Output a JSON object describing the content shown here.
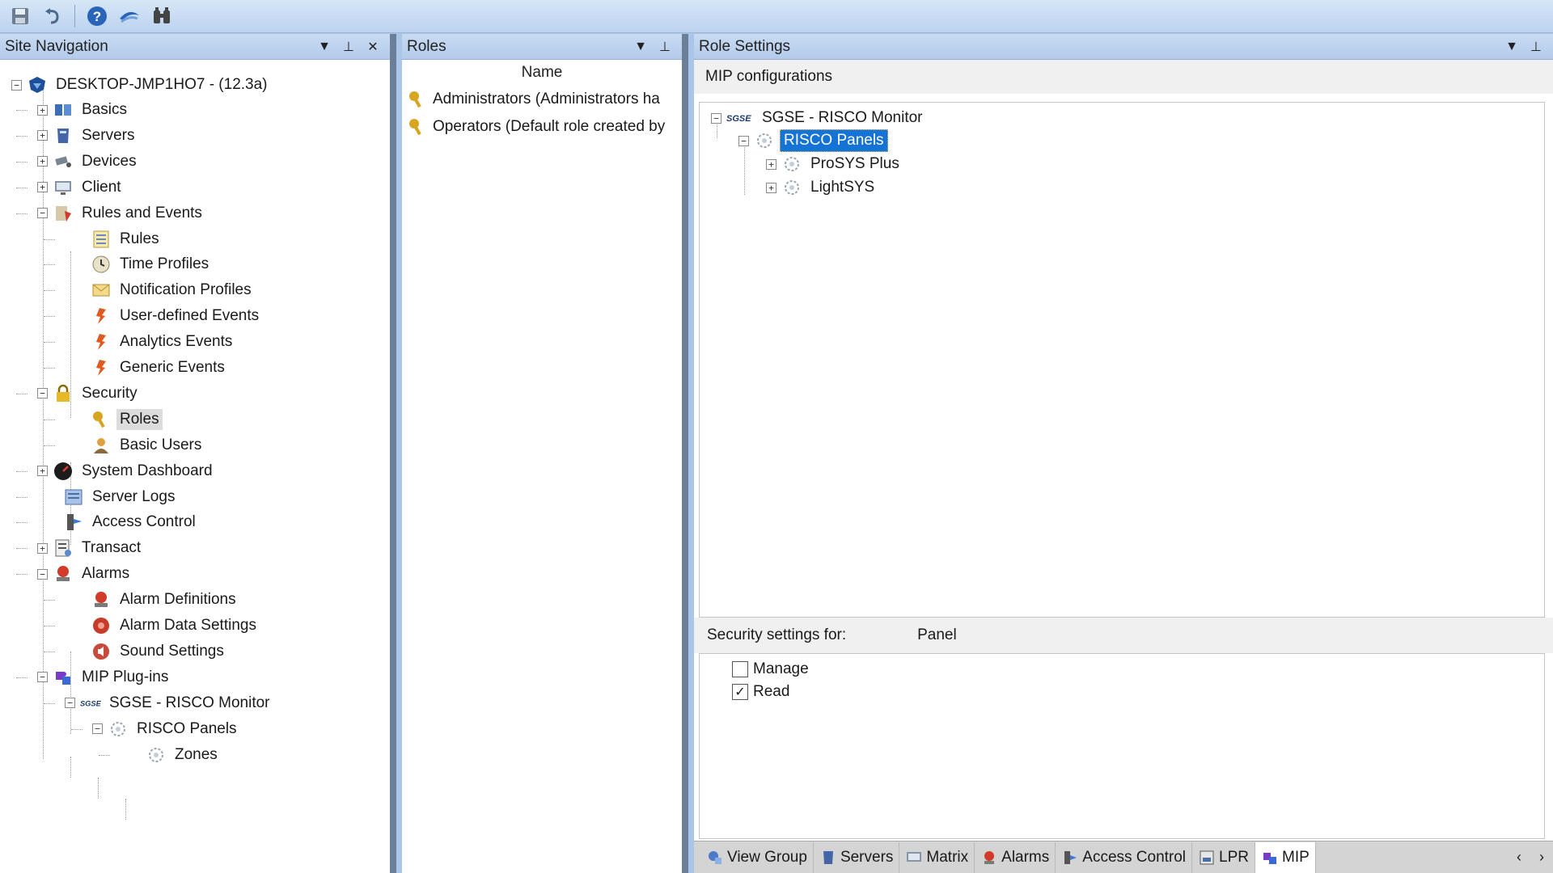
{
  "toolbar": {
    "icons": [
      "save-icon",
      "undo-icon",
      "help-icon",
      "refresh-icon",
      "find-icon"
    ]
  },
  "nav": {
    "title": "Site Navigation",
    "root": "DESKTOP-JMP1HO7 - (12.3a)",
    "items": [
      {
        "label": "Basics",
        "toggle": "+"
      },
      {
        "label": "Servers",
        "toggle": "+"
      },
      {
        "label": "Devices",
        "toggle": "+"
      },
      {
        "label": "Client",
        "toggle": "+"
      },
      {
        "label": "Rules and Events",
        "toggle": "-"
      },
      {
        "label": "Rules"
      },
      {
        "label": "Time Profiles"
      },
      {
        "label": "Notification Profiles"
      },
      {
        "label": "User-defined Events"
      },
      {
        "label": "Analytics Events"
      },
      {
        "label": "Generic Events"
      },
      {
        "label": "Security",
        "toggle": "-"
      },
      {
        "label": "Roles"
      },
      {
        "label": "Basic Users"
      },
      {
        "label": "System Dashboard",
        "toggle": "+"
      },
      {
        "label": "Server Logs"
      },
      {
        "label": "Access Control"
      },
      {
        "label": "Transact",
        "toggle": "+"
      },
      {
        "label": "Alarms",
        "toggle": "-"
      },
      {
        "label": "Alarm Definitions"
      },
      {
        "label": "Alarm Data Settings"
      },
      {
        "label": "Sound Settings"
      },
      {
        "label": "MIP Plug-ins",
        "toggle": "-"
      },
      {
        "label": "SGSE - RISCO Monitor",
        "toggle": "-"
      },
      {
        "label": "RISCO Panels",
        "toggle": "-"
      },
      {
        "label": "Zones"
      }
    ]
  },
  "roles": {
    "title": "Roles",
    "column": "Name",
    "rows": [
      "Administrators (Administrators ha",
      "Operators (Default role created by"
    ]
  },
  "settings": {
    "title": "Role Settings",
    "section": "MIP configurations",
    "tree": {
      "root": "SGSE - RISCO Monitor",
      "child": "RISCO Panels",
      "leaves": [
        "ProSYS Plus",
        "LightSYS"
      ]
    },
    "security_label": "Security settings for:",
    "security_value": "Panel",
    "permissions": [
      {
        "label": "Manage",
        "checked": false
      },
      {
        "label": "Read",
        "checked": true
      }
    ],
    "tabs": [
      "View Group",
      "Servers",
      "Matrix",
      "Alarms",
      "Access Control",
      "LPR",
      "MIP"
    ],
    "active_tab": "MIP"
  },
  "colors": {
    "selection": "#1673d6",
    "header": "#b3cbea",
    "splitter": "#6c7f98"
  }
}
